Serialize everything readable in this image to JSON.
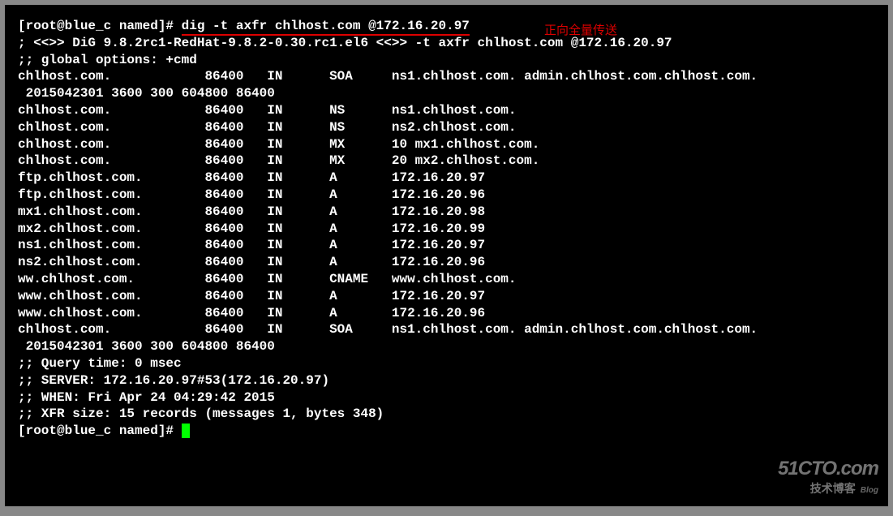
{
  "prompt1_user": "[root@blue_c named]# ",
  "command": "dig -t axfr chlhost.com @172.16.20.97",
  "annotation": "正向全量传送",
  "output_lines": [
    "",
    "; <<>> DiG 9.8.2rc1-RedHat-9.8.2-0.30.rc1.el6 <<>> -t axfr chlhost.com @172.16.20.97",
    ";; global options: +cmd",
    "chlhost.com.            86400   IN      SOA     ns1.chlhost.com. admin.chlhost.com.chlhost.com.",
    " 2015042301 3600 300 604800 86400",
    "chlhost.com.            86400   IN      NS      ns1.chlhost.com.",
    "chlhost.com.            86400   IN      NS      ns2.chlhost.com.",
    "chlhost.com.            86400   IN      MX      10 mx1.chlhost.com.",
    "chlhost.com.            86400   IN      MX      20 mx2.chlhost.com.",
    "ftp.chlhost.com.        86400   IN      A       172.16.20.97",
    "ftp.chlhost.com.        86400   IN      A       172.16.20.96",
    "mx1.chlhost.com.        86400   IN      A       172.16.20.98",
    "mx2.chlhost.com.        86400   IN      A       172.16.20.99",
    "ns1.chlhost.com.        86400   IN      A       172.16.20.97",
    "ns2.chlhost.com.        86400   IN      A       172.16.20.96",
    "ww.chlhost.com.         86400   IN      CNAME   www.chlhost.com.",
    "www.chlhost.com.        86400   IN      A       172.16.20.97",
    "www.chlhost.com.        86400   IN      A       172.16.20.96",
    "chlhost.com.            86400   IN      SOA     ns1.chlhost.com. admin.chlhost.com.chlhost.com.",
    " 2015042301 3600 300 604800 86400",
    ";; Query time: 0 msec",
    ";; SERVER: 172.16.20.97#53(172.16.20.97)",
    ";; WHEN: Fri Apr 24 04:29:42 2015",
    ";; XFR size: 15 records (messages 1, bytes 348)",
    ""
  ],
  "prompt2_user": "[root@blue_c named]# ",
  "watermark_top": "51CTO.com",
  "watermark_bot": "技术博客",
  "watermark_blog": "Blog"
}
